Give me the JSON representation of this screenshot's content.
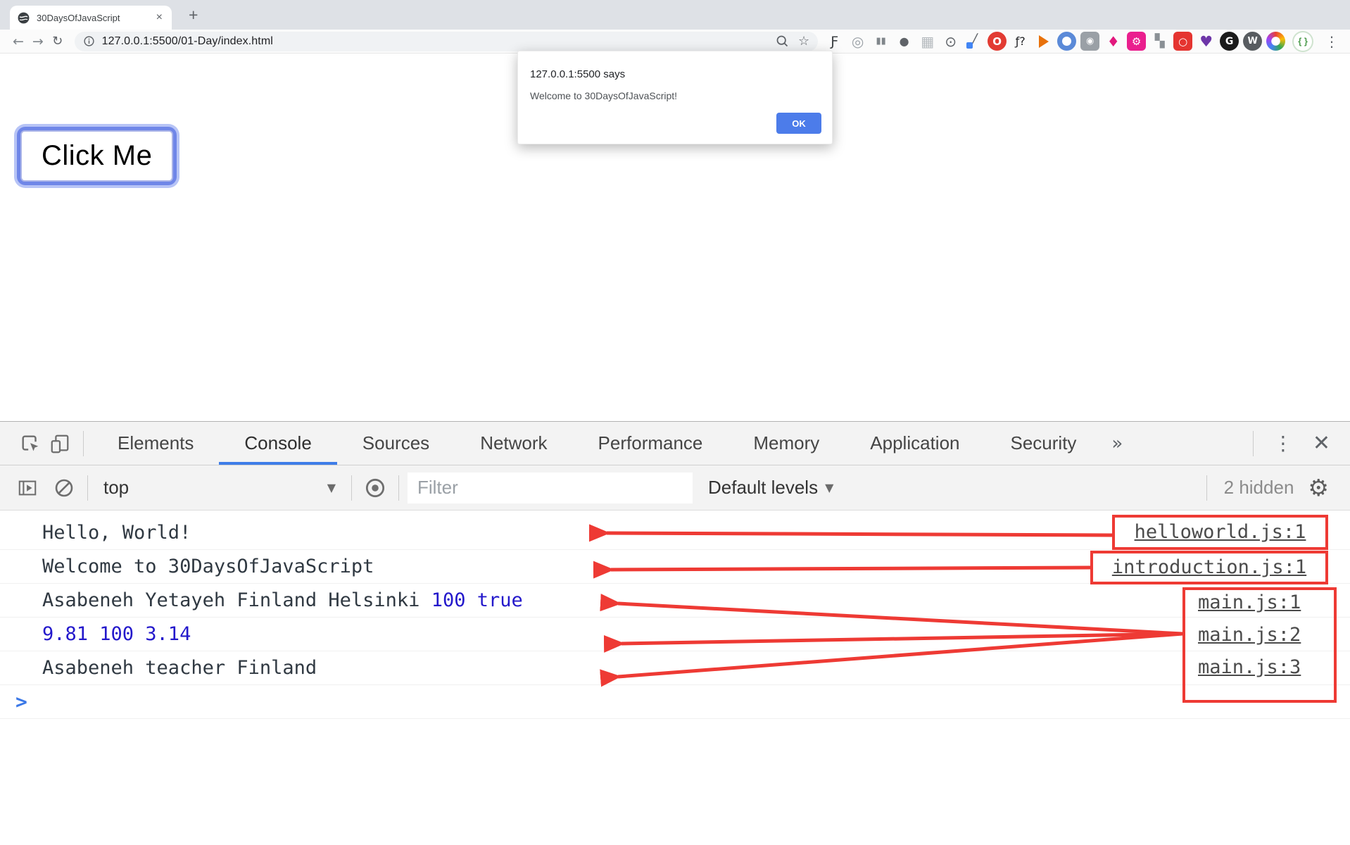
{
  "browser": {
    "tab_title": "30DaysOfJavaScript",
    "close_tab_glyph": "×",
    "new_tab_glyph": "+",
    "nav": {
      "back": "←",
      "forward": "→",
      "reload": "↻"
    },
    "url": "127.0.0.1:5500/01-Day/index.html",
    "bookmark_glyph": "☆",
    "avatar_glyph": "{ }",
    "menu_glyph": "⋮",
    "extension_icons": [
      {
        "name": "font-script-extension-icon",
        "glyph": "Ƒ",
        "color": "#3c4043",
        "size": 19
      },
      {
        "name": "target-extension-icon",
        "glyph": "◎",
        "color": "#9aa0a6",
        "size": 20
      },
      {
        "name": "reader-bars-extension-icon",
        "glyph": "▮▮",
        "color": "#80868b",
        "size": 13
      },
      {
        "name": "bug-extension-icon",
        "glyph": "●",
        "color": "#5f6368",
        "size": 16
      },
      {
        "name": "grid-extension-icon",
        "glyph": "▦",
        "color": "#b5babe",
        "size": 20
      },
      {
        "name": "braces-circle-extension-icon",
        "glyph": "⊙",
        "color": "#5f6368",
        "size": 20
      },
      {
        "name": "eyedropper-extension-icon",
        "glyph": "╱",
        "color": "#5f6368",
        "size": 18,
        "shape": "eyedropper"
      },
      {
        "name": "red-circle-o-extension-icon",
        "glyph": "O",
        "color": "#ffffff",
        "bg": "#e23b32",
        "size": 15,
        "bold": true,
        "shape": "circle"
      },
      {
        "name": "function-help-extension-icon",
        "glyph": "ƒ?",
        "color": "#202124",
        "size": 16
      },
      {
        "name": "megaphone-extension-icon",
        "shape": "megaphone"
      },
      {
        "name": "blue-ring-extension-icon",
        "shape": "ring-blue"
      },
      {
        "name": "camera-extension-icon",
        "glyph": "◉",
        "color": "#ffffff",
        "bg": "#9aa0a6",
        "size": 13,
        "shape": "rsquare"
      },
      {
        "name": "pink-star-extension-icon",
        "glyph": "♦",
        "color": "#e2187d",
        "size": 20
      },
      {
        "name": "pink-gear-extension-icon",
        "glyph": "⚙",
        "color": "#ffffff",
        "bg": "#ea1f8e",
        "size": 15,
        "shape": "rsquare"
      },
      {
        "name": "blocks-extension-icon",
        "glyph": "▚",
        "color": "#8a9095",
        "size": 18
      },
      {
        "name": "red-ring-extension-icon",
        "glyph": "○",
        "color": "#ffffff",
        "bg": "#e53430",
        "size": 15,
        "bold": true,
        "shape": "rsquare"
      },
      {
        "name": "heart-search-extension-icon",
        "glyph": "♥",
        "color": "#6d36a8",
        "size": 21
      },
      {
        "name": "g-circle-extension-icon",
        "glyph": "G",
        "color": "#ffffff",
        "bg": "#1b1b1b",
        "size": 14,
        "bold": true,
        "shape": "circle"
      },
      {
        "name": "w-circle-extension-icon",
        "glyph": "W",
        "color": "#ffffff",
        "bg": "#585c60",
        "size": 13,
        "bold": true,
        "shape": "circle"
      },
      {
        "name": "rainbow-ring-extension-icon",
        "shape": "ring-rainbow"
      }
    ]
  },
  "page": {
    "click_me_label": "Click Me"
  },
  "alert": {
    "title": "127.0.0.1:5500 says",
    "message": "Welcome to 30DaysOfJavaScript!",
    "ok_label": "OK"
  },
  "devtools": {
    "tabs": [
      "Elements",
      "Console",
      "Sources",
      "Network",
      "Performance",
      "Memory",
      "Application",
      "Security"
    ],
    "active_tab": "Console",
    "more_tabs_glyph": "»",
    "menu_glyph": "⋮",
    "close_glyph": "✕",
    "toolbar": {
      "context": "top",
      "dropdown_glyph": "▼",
      "filter_placeholder": "Filter",
      "levels_label": "Default levels",
      "hidden_count": "2 hidden",
      "settings_glyph": "⚙"
    },
    "console": {
      "messages": [
        {
          "text": "Hello, World!",
          "value": "",
          "source": "helloworld.js:1"
        },
        {
          "text": "Welcome to 30DaysOfJavaScript",
          "value": "",
          "source": "introduction.js:1"
        },
        {
          "text": "Asabeneh Yetayeh Finland Helsinki ",
          "value": "100 true",
          "source": "main.js:1"
        },
        {
          "text": "",
          "value": "9.81 100 3.14",
          "source": "main.js:2"
        },
        {
          "text": "Asabeneh teacher Finland",
          "value": "",
          "source": "main.js:3"
        }
      ],
      "prompt_glyph": ">"
    },
    "colors": {
      "annotation_red": "#ee3a34",
      "number_blue": "#2318cb",
      "accent_blue": "#3e7de8"
    }
  }
}
